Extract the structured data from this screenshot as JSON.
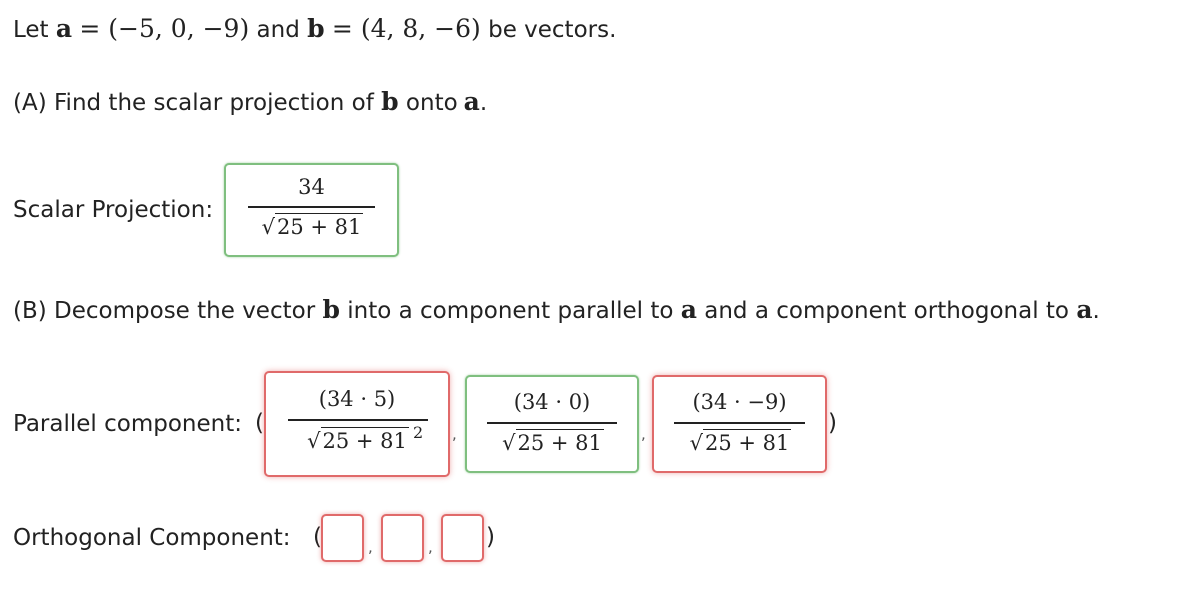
{
  "intro": {
    "prefix": "Let",
    "a_sym": "a",
    "eq1": "= (−5, 0, −9)",
    "and": "and",
    "b_sym": "b",
    "eq2": "= (4, 8, −6)",
    "suffix": "be vectors."
  },
  "partA": {
    "text1": "(A) Find the scalar projection of",
    "b_sym": "b",
    "text2": "onto",
    "a_sym": "a",
    "period": ".",
    "label": "Scalar Projection:",
    "answer": {
      "numerator": "34",
      "radicand": "25 + 81",
      "status": "correct"
    }
  },
  "partB": {
    "text1": "(B) Decompose the vector",
    "b_sym": "b",
    "text2": "into a component parallel to",
    "a_sym": "a",
    "text3": "and a component orthogonal to",
    "a_sym2": "a",
    "period": ".",
    "parallel_label": "Parallel component:",
    "parallel": [
      {
        "numerator": "(34 · 5)",
        "radicand": "25 + 81",
        "exponent": "2",
        "status": "incorrect"
      },
      {
        "numerator": "(34 · 0)",
        "radicand": "25 + 81",
        "exponent": "",
        "status": "correct"
      },
      {
        "numerator": "(34 · −9)",
        "radicand": "25 + 81",
        "exponent": "",
        "status": "incorrect"
      }
    ],
    "orthogonal_label": "Orthogonal Component:",
    "orthogonal": [
      "",
      "",
      ""
    ]
  },
  "symbols": {
    "open_paren": "(",
    "close_paren": ")",
    "comma": ",",
    "sqrt": "√"
  },
  "colors": {
    "correct_border": "#7fbf7f",
    "incorrect_border": "#e06a6a"
  }
}
